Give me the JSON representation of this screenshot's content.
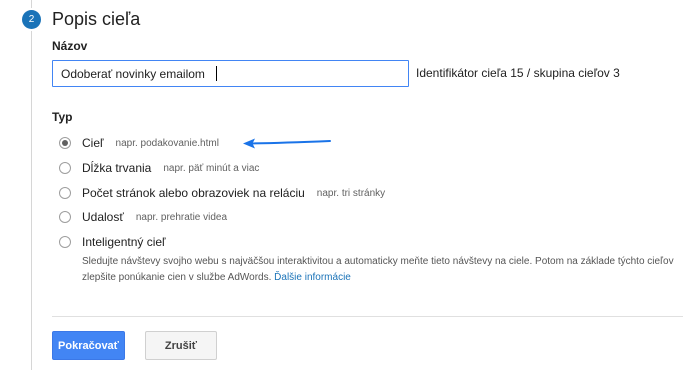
{
  "step": {
    "number": "2",
    "title": "Popis cieľa"
  },
  "name_field": {
    "label": "Názov",
    "value": "Odoberať novinky emailom",
    "goal_id": "Identifikátor cieľa 15 / skupina cieľov 3"
  },
  "type_section": {
    "label": "Typ",
    "options": [
      {
        "label": "Cieľ",
        "hint": "napr. podakovanie.html",
        "checked": true
      },
      {
        "label": "Dĺžka trvania",
        "hint": "napr. päť minút a viac",
        "checked": false
      },
      {
        "label": "Počet stránok alebo obrazoviek na reláciu",
        "hint": "napr. tri stránky",
        "checked": false
      },
      {
        "label": "Udalosť",
        "hint": "napr. prehratie videa",
        "checked": false
      },
      {
        "label": "Inteligentný cieľ",
        "hint": "",
        "checked": false
      }
    ],
    "smart_goal_description": "Sledujte návštevy svojho webu s najväčšou interaktivitou a automaticky meňte tieto návštevy na ciele. Potom na základe týchto cieľov zlepšite ponúkanie cien v službe AdWords.",
    "learn_more": "Ďalšie informácie"
  },
  "buttons": {
    "continue": "Pokračovať",
    "cancel": "Zrušiť"
  },
  "colors": {
    "accent": "#4285f4",
    "step_circle": "#1a73b8",
    "annotation_arrow": "#1a73e8"
  },
  "icons": {
    "annotation": "arrow-left-icon"
  }
}
